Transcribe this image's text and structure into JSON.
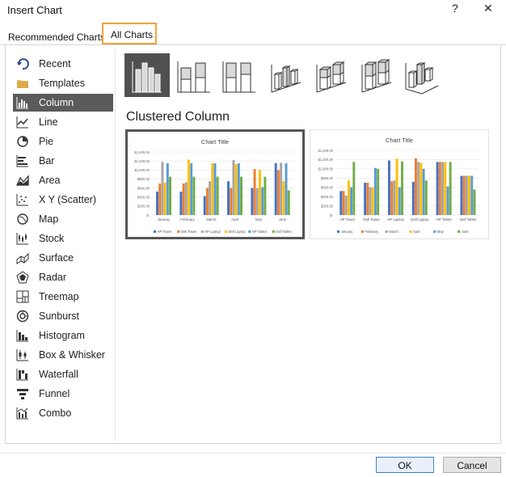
{
  "window": {
    "title": "Insert Chart",
    "help_glyph": "?",
    "close_glyph": "✕"
  },
  "tabs": [
    {
      "label": "Recommended Charts",
      "active": false
    },
    {
      "label": "All Charts",
      "active": true
    }
  ],
  "sidebar": {
    "items": [
      {
        "label": "Recent",
        "icon": "recent-icon"
      },
      {
        "label": "Templates",
        "icon": "folder-icon"
      },
      {
        "label": "Column",
        "icon": "column-chart-icon",
        "active": true
      },
      {
        "label": "Line",
        "icon": "line-chart-icon"
      },
      {
        "label": "Pie",
        "icon": "pie-chart-icon"
      },
      {
        "label": "Bar",
        "icon": "bar-chart-icon"
      },
      {
        "label": "Area",
        "icon": "area-chart-icon"
      },
      {
        "label": "X Y (Scatter)",
        "icon": "scatter-chart-icon"
      },
      {
        "label": "Map",
        "icon": "map-chart-icon"
      },
      {
        "label": "Stock",
        "icon": "stock-chart-icon"
      },
      {
        "label": "Surface",
        "icon": "surface-chart-icon"
      },
      {
        "label": "Radar",
        "icon": "radar-chart-icon"
      },
      {
        "label": "Treemap",
        "icon": "treemap-chart-icon"
      },
      {
        "label": "Sunburst",
        "icon": "sunburst-chart-icon"
      },
      {
        "label": "Histogram",
        "icon": "histogram-chart-icon"
      },
      {
        "label": "Box & Whisker",
        "icon": "box-whisker-chart-icon"
      },
      {
        "label": "Waterfall",
        "icon": "waterfall-chart-icon"
      },
      {
        "label": "Funnel",
        "icon": "funnel-chart-icon"
      },
      {
        "label": "Combo",
        "icon": "combo-chart-icon"
      }
    ]
  },
  "subtypes": {
    "items": [
      {
        "name": "clustered-column",
        "selected": true
      },
      {
        "name": "stacked-column"
      },
      {
        "name": "100-percent-stacked-column"
      },
      {
        "name": "3d-clustered-column"
      },
      {
        "name": "3d-stacked-column"
      },
      {
        "name": "3d-100-percent-stacked-column"
      },
      {
        "name": "3d-column"
      }
    ],
    "selected_heading": "Clustered Column"
  },
  "colors": {
    "accent_orange": "#f2a23a",
    "series": [
      "#4472c4",
      "#ed7d31",
      "#a5a5a5",
      "#ffc000",
      "#5b9bd5",
      "#70ad47"
    ]
  },
  "chart_data": [
    {
      "type": "bar",
      "title": "Chart Title",
      "ylim": [
        0,
        1400
      ],
      "yticks": [
        "$-",
        "$200.00",
        "$400.00",
        "$600.00",
        "$800.00",
        "$1,000.00",
        "$1,200.00",
        "$1,400.00"
      ],
      "categories": [
        "January",
        "February",
        "March",
        "April",
        "May",
        "June"
      ],
      "series": [
        {
          "name": "HP Tower",
          "values": [
            520,
            520,
            420,
            750,
            600,
            1150
          ]
        },
        {
          "name": "Dell Tower",
          "values": [
            700,
            700,
            600,
            600,
            1020,
            1000
          ]
        },
        {
          "name": "HP Laptop",
          "values": [
            1180,
            730,
            750,
            1220,
            600,
            1160
          ]
        },
        {
          "name": "Dell Laptop",
          "values": [
            720,
            1230,
            1150,
            1130,
            1000,
            750
          ]
        },
        {
          "name": "HP Tablet",
          "values": [
            1150,
            1150,
            1150,
            1150,
            620,
            1150
          ]
        },
        {
          "name": "Dell Tablet",
          "values": [
            850,
            850,
            850,
            850,
            850,
            550
          ]
        }
      ]
    },
    {
      "type": "bar",
      "title": "Chart Title",
      "ylim": [
        0,
        1400
      ],
      "yticks": [
        "$-",
        "$200.00",
        "$400.00",
        "$600.00",
        "$800.00",
        "$1,000.00",
        "$1,200.00",
        "$1,400.00"
      ],
      "categories": [
        "HP Tower",
        "Dell Tower",
        "HP Laptop",
        "Dell Laptop",
        "HP Tablet",
        "Dell Tablet"
      ],
      "series": [
        {
          "name": "January",
          "values": [
            520,
            700,
            1180,
            720,
            1150,
            850
          ]
        },
        {
          "name": "February",
          "values": [
            520,
            700,
            730,
            1230,
            1150,
            850
          ]
        },
        {
          "name": "March",
          "values": [
            420,
            600,
            750,
            1150,
            1150,
            850
          ]
        },
        {
          "name": "April",
          "values": [
            750,
            600,
            1220,
            1130,
            1150,
            850
          ]
        },
        {
          "name": "May",
          "values": [
            600,
            1020,
            600,
            1000,
            620,
            850
          ]
        },
        {
          "name": "June",
          "values": [
            1150,
            1000,
            1160,
            750,
            1150,
            550
          ]
        }
      ]
    }
  ],
  "footer": {
    "ok_label": "OK",
    "cancel_label": "Cancel"
  }
}
